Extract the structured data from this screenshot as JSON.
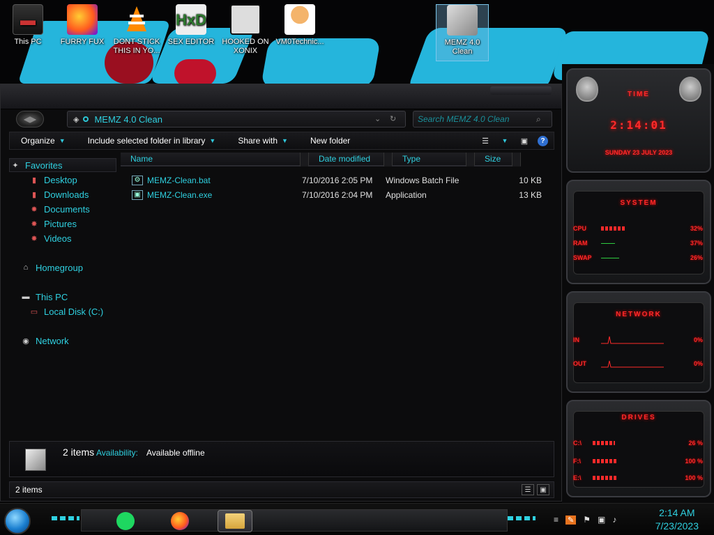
{
  "desktop": {
    "icons": [
      {
        "label": "This PC",
        "glyph": "pc-icon"
      },
      {
        "label": "FURRY FUX",
        "glyph": "firefox-icon"
      },
      {
        "label": "DONT STICK THIS IN YO...",
        "glyph": "vlc-icon"
      },
      {
        "label": "SEX EDITOR",
        "glyph": "hxd-icon"
      },
      {
        "label": "HOOKED ON XONIX",
        "glyph": "xonix-icon"
      },
      {
        "label": "VM0Technic...",
        "glyph": "person-icon"
      },
      {
        "label": "MEMZ 4.0 Clean",
        "glyph": "memz-icon"
      }
    ]
  },
  "explorer": {
    "address": "MEMZ 4.0 Clean",
    "search_placeholder": "Search MEMZ 4.0 Clean",
    "toolbar": {
      "organize": "Organize",
      "include": "Include selected folder in library",
      "share": "Share with",
      "new_folder": "New folder",
      "help": "?"
    },
    "nav": {
      "favorites": "Favorites",
      "desktop": "Desktop",
      "downloads": "Downloads",
      "documents": "Documents",
      "pictures": "Pictures",
      "videos": "Videos",
      "homegroup": "Homegroup",
      "this_pc": "This PC",
      "local_disk": "Local Disk (C:)",
      "network": "Network"
    },
    "columns": {
      "name": "Name",
      "date": "Date modified",
      "type": "Type",
      "size": "Size"
    },
    "files": [
      {
        "name": "MEMZ-Clean.bat",
        "date": "7/10/2016 2:05 PM",
        "type": "Windows Batch File",
        "size": "10 KB"
      },
      {
        "name": "MEMZ-Clean.exe",
        "date": "7/10/2016 2:04 PM",
        "type": "Application",
        "size": "13 KB"
      }
    ],
    "details": {
      "count": "2 items",
      "availability_label": "Availability:",
      "availability_value": "Available offline"
    },
    "status": "2 items"
  },
  "gadgets": {
    "time": {
      "title": "TIME",
      "clock": "2:14:01",
      "date": "SUNDAY 23 JULY 2023"
    },
    "system": {
      "title": "SYSTEM",
      "cpu_label": "CPU",
      "cpu": "32%",
      "ram_label": "RAM",
      "ram": "37%",
      "swap_label": "SWAP",
      "swap": "26%"
    },
    "network": {
      "title": "NETWORK",
      "in_label": "IN",
      "in": "0%",
      "out_label": "OUT",
      "out": "0%"
    },
    "drives": {
      "title": "DRIVES",
      "c_label": "C:\\",
      "c": "26 %",
      "f_label": "F:\\",
      "f": "100 %",
      "e_label": "E:\\",
      "e": "100 %"
    }
  },
  "taskbar": {
    "time": "2:14 AM",
    "date": "7/23/2023"
  },
  "colors": {
    "accent": "#2fd0e0",
    "gadget_red": "#ff2a2a"
  }
}
